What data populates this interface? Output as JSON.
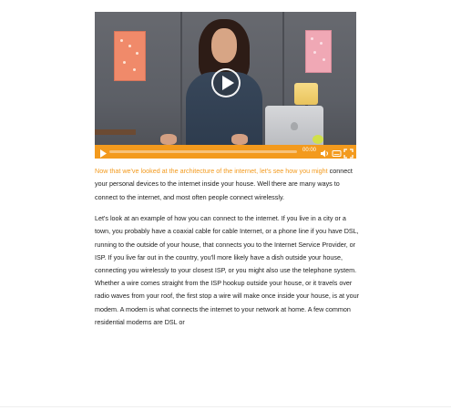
{
  "video": {
    "time": "00:00",
    "progress_fraction": 0.0,
    "icons": [
      "play-icon",
      "volume-icon",
      "captions-icon",
      "fullscreen-icon"
    ],
    "accent_color": "#f39a1d"
  },
  "transcript": {
    "p1_highlight": "Now that we've looked at the architecture of the internet, let's see how you might",
    "p1_rest": " connect your personal devices to the internet inside your house. Well there are many ways to connect to the internet, and most often people connect wirelessly.",
    "p2": "Let's look at an example of how you can connect to the internet. If you live in a city or a town, you probably have a coaxial cable for cable Internet, or a phone line if you have DSL, running to the outside of your house, that connects you to the Internet Service Provider, or ISP. If you live far out in the country, you'll more likely have a dish outside your house, connecting you wirelessly to your closest ISP, or you might also use the telephone system.",
    "p3": "Whether a wire comes straight from the ISP hookup outside your house, or it travels over radio waves from your roof, the first stop a wire will make once inside your house, is at your modem. A modem is what connects the internet to your network at home. A few common residential modems are DSL or"
  }
}
